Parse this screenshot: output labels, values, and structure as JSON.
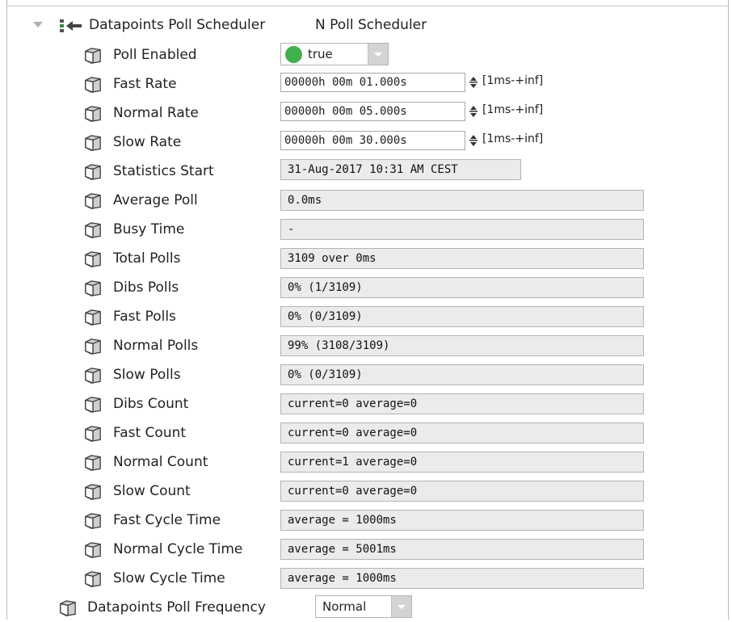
{
  "scheduler": {
    "title": "Datapoints Poll Scheduler",
    "type": "N Poll Scheduler"
  },
  "poll_enabled": {
    "label": "Poll Enabled",
    "value": "true",
    "status_color": "#3fb14b"
  },
  "rates": [
    {
      "label": "Fast Rate",
      "value": "00000h 00m 01.000s",
      "range": "[1ms-+inf]"
    },
    {
      "label": "Normal Rate",
      "value": "00000h 00m 05.000s",
      "range": "[1ms-+inf]"
    },
    {
      "label": "Slow Rate",
      "value": "00000h 00m 30.000s",
      "range": "[1ms-+inf]"
    }
  ],
  "statistics_start": {
    "label": "Statistics Start",
    "value": "31-Aug-2017 10:31 AM CEST"
  },
  "stats": [
    {
      "label": "Average Poll",
      "value": "0.0ms"
    },
    {
      "label": "Busy Time",
      "value": "-"
    },
    {
      "label": "Total Polls",
      "value": "3109 over 0ms"
    },
    {
      "label": "Dibs Polls",
      "value": "0% (1/3109)"
    },
    {
      "label": "Fast Polls",
      "value": "0% (0/3109)"
    },
    {
      "label": "Normal Polls",
      "value": "99% (3108/3109)"
    },
    {
      "label": "Slow Polls",
      "value": "0% (0/3109)"
    },
    {
      "label": "Dibs Count",
      "value": "current=0 average=0"
    },
    {
      "label": "Fast Count",
      "value": "current=0 average=0"
    },
    {
      "label": "Normal Count",
      "value": "current=1 average=0"
    },
    {
      "label": "Slow Count",
      "value": "current=0 average=0"
    },
    {
      "label": "Fast Cycle Time",
      "value": "average = 1000ms"
    },
    {
      "label": "Normal Cycle Time",
      "value": "average = 5001ms"
    },
    {
      "label": "Slow Cycle Time",
      "value": "average = 1000ms"
    }
  ],
  "poll_frequency": {
    "label": "Datapoints Poll Frequency",
    "value": "Normal"
  }
}
